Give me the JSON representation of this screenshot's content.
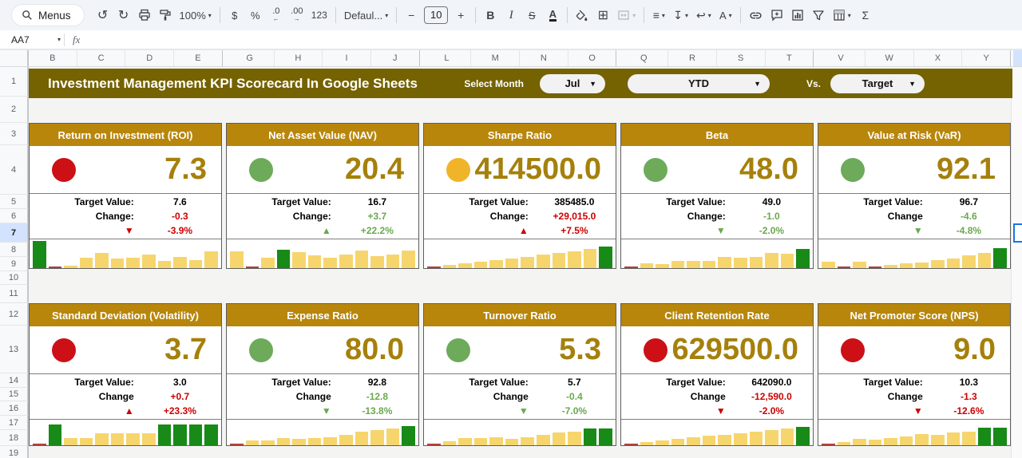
{
  "toolbar": {
    "menus_label": "Menus",
    "zoom": "100%",
    "currency": "$",
    "percent": "%",
    "decrease_decimal": ".0",
    "decrease_decimal_arrow": "←",
    "increase_decimal": ".00",
    "increase_decimal_arrow": "→",
    "number_format": "123",
    "font_name": "Defaul...",
    "font_size_minus": "−",
    "font_size": "10",
    "font_size_plus": "+",
    "bold": "B",
    "italic": "I",
    "strikethrough": "S",
    "text_color": "A",
    "align": "≡",
    "vertical_align": "↧",
    "text_wrap": "↩",
    "text_rotation": "A",
    "functions": "Σ",
    "glyphs": {
      "undo": "↺",
      "redo": "↻",
      "caret": "▾",
      "borders": "⊞"
    }
  },
  "formula_bar": {
    "name_box": "AA7",
    "fx": "fx"
  },
  "columns": {
    "groups": [
      [
        "B",
        "C",
        "D",
        "E"
      ],
      [
        "G",
        "H",
        "I",
        "J"
      ],
      [
        "L",
        "M",
        "N",
        "O"
      ],
      [
        "Q",
        "R",
        "S",
        "T"
      ],
      [
        "V",
        "W",
        "X",
        "Y"
      ]
    ]
  },
  "rows": {
    "labels": [
      "1",
      "2",
      "3",
      "4",
      "5",
      "6",
      "7",
      "8",
      "9",
      "10",
      "11",
      "12",
      "13",
      "14",
      "15",
      "16",
      "17",
      "18",
      "19"
    ],
    "selected": "7"
  },
  "banner": {
    "title": "Investment Management KPI Scorecard In Google Sheets",
    "select_month_label": "Select Month",
    "month": "Jul",
    "period": "YTD",
    "vs_label": "Vs.",
    "compare": "Target",
    "caret": "▼"
  },
  "ui": {
    "arrow_up": "▲",
    "arrow_down": "▼"
  },
  "colors": {
    "banner_bg": "#756200",
    "card_header_bg": "#b8860b",
    "kpi_value": "#a5800b",
    "red_text": "#cc0000",
    "green_text": "#6aa84f",
    "dot_red": "#cc1016",
    "dot_green": "#6daa5a",
    "dot_yellow": "#f0b429",
    "bar_yellow": "#f6d56d",
    "bar_green": "#178a17",
    "bar_red": "#b0413a",
    "selected_header": "#d3e3fd",
    "selection_border": "#1a73e8"
  },
  "cards": [
    {
      "title": "Return on Investment (ROI)",
      "status": "red",
      "value": "7.3",
      "target_label": "Target Value:",
      "target": "7.6",
      "change_label": "Change:",
      "change": "-0.3",
      "change_color": "red",
      "arrow": "down",
      "arrow_color": "red",
      "pct": "-3.9%",
      "pct_color": "red",
      "spark": [
        "g:95",
        "r:6",
        "y:9",
        "y:36",
        "y:52",
        "y:33",
        "y:36",
        "y:46",
        "y:26",
        "y:40",
        "y:28",
        "y:58"
      ]
    },
    {
      "title": "Net Asset Value (NAV)",
      "status": "green",
      "value": "20.4",
      "target_label": "Target Value:",
      "target": "16.7",
      "change_label": "Change:",
      "change": "+3.7",
      "change_color": "green",
      "arrow": "up",
      "arrow_color": "green",
      "pct": "+22.2%",
      "pct_color": "green",
      "spark": [
        "y:58",
        "r:6",
        "y:36",
        "g:64",
        "y:56",
        "y:44",
        "y:36",
        "y:48",
        "y:60",
        "y:42",
        "y:48",
        "y:60"
      ]
    },
    {
      "title": "Sharpe Ratio",
      "status": "yellow",
      "value": "414500.0",
      "target_label": "Target Value:",
      "target": "385485.0",
      "change_label": "Change:",
      "change": "+29,015.0",
      "change_color": "red",
      "arrow": "up",
      "arrow_color": "red",
      "pct": "+7.5%",
      "pct_color": "red",
      "spark": [
        "r:5",
        "y:10",
        "y:16",
        "y:22",
        "y:28",
        "y:34",
        "y:40",
        "y:46",
        "y:52",
        "y:58",
        "y:66",
        "g:74"
      ]
    },
    {
      "title": "Beta",
      "status": "green",
      "value": "48.0",
      "target_label": "Target Value:",
      "target": "49.0",
      "change_label": "Change:",
      "change": "-1.0",
      "change_color": "green",
      "arrow": "down",
      "arrow_color": "green",
      "pct": "-2.0%",
      "pct_color": "green",
      "spark": [
        "r:5",
        "y:17",
        "y:14",
        "y:26",
        "y:24",
        "y:24",
        "y:40",
        "y:36",
        "y:38",
        "y:52",
        "y:50",
        "g:66"
      ]
    },
    {
      "title": "Value at Risk (VaR)",
      "status": "green",
      "value": "92.1",
      "target_label": "Target Value:",
      "target": "96.7",
      "change_label": "Change",
      "change": "-4.6",
      "change_color": "green",
      "arrow": "down",
      "arrow_color": "green",
      "pct": "-4.8%",
      "pct_color": "green",
      "spark": [
        "y:22",
        "r:6",
        "y:22",
        "r:6",
        "y:10",
        "y:17",
        "y:19",
        "y:27",
        "y:34",
        "y:44",
        "y:52",
        "g:70"
      ]
    },
    {
      "title": "Standard Deviation (Volatility)",
      "status": "red",
      "value": "3.7",
      "target_label": "Target Value:",
      "target": "3.0",
      "change_label": "Change",
      "change": "+0.7",
      "change_color": "red",
      "arrow": "up",
      "arrow_color": "red",
      "pct": "+23.3%",
      "pct_color": "red",
      "spark": [
        "r:6",
        "g:82",
        "y:28",
        "y:28",
        "y:46",
        "y:46",
        "y:46",
        "y:46",
        "g:82",
        "g:82",
        "g:82",
        "g:82"
      ]
    },
    {
      "title": "Expense Ratio",
      "status": "green",
      "value": "80.0",
      "target_label": "Target Value:",
      "target": "92.8",
      "change_label": "Change",
      "change": "-12.8",
      "change_color": "green",
      "arrow": "down",
      "arrow_color": "green",
      "pct": "-13.8%",
      "pct_color": "green",
      "spark": [
        "r:6",
        "y:20",
        "y:19",
        "y:28",
        "y:26",
        "y:28",
        "y:30",
        "y:42",
        "y:52",
        "y:60",
        "y:66",
        "g:74"
      ]
    },
    {
      "title": "Turnover Ratio",
      "status": "green",
      "value": "5.3",
      "target_label": "Target Value:",
      "target": "5.7",
      "change_label": "Change",
      "change": "-0.4",
      "change_color": "green",
      "arrow": "down",
      "arrow_color": "green",
      "pct": "-7.0%",
      "pct_color": "green",
      "spark": [
        "r:5",
        "y:17",
        "y:28",
        "y:28",
        "y:30",
        "y:26",
        "y:30",
        "y:42",
        "y:50",
        "y:52",
        "g:66",
        "g:66"
      ]
    },
    {
      "title": "Client Retention Rate",
      "status": "red",
      "value": "629500.0",
      "target_label": "Target Value:",
      "target": "642090.0",
      "change_label": "Change",
      "change": "-12,590.0",
      "change_color": "red",
      "arrow": "down",
      "arrow_color": "red",
      "pct": "-2.0%",
      "pct_color": "red",
      "spark": [
        "r:5",
        "y:12",
        "y:18",
        "y:24",
        "y:30",
        "y:36",
        "y:42",
        "y:47",
        "y:52",
        "y:58",
        "y:65",
        "g:72"
      ]
    },
    {
      "title": "Net Promoter Score (NPS)",
      "status": "red",
      "value": "9.0",
      "target_label": "Target Value:",
      "target": "10.3",
      "change_label": "Change",
      "change": "-1.3",
      "change_color": "red",
      "arrow": "down",
      "arrow_color": "red",
      "pct": "-12.6%",
      "pct_color": "red",
      "spark": [
        "r:5",
        "y:14",
        "y:24",
        "y:21",
        "y:29",
        "y:34",
        "y:43",
        "y:41",
        "y:50",
        "y:54",
        "g:68",
        "g:68"
      ]
    }
  ]
}
